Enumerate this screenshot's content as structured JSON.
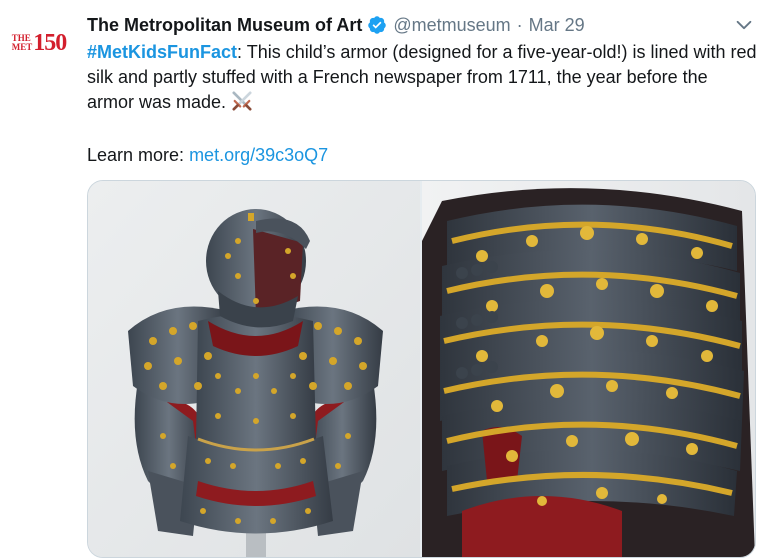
{
  "tweet": {
    "avatar": {
      "logo_small": "THE\nMET",
      "logo_number": "150"
    },
    "display_name": "The Metropolitan Museum of Art",
    "handle": "@metmuseum",
    "separator": "·",
    "date": "Mar 29",
    "hashtag": "#MetKidsFunFact",
    "body": ": This child’s armor (designed for a five-year-old!) is lined with red silk and partly stuffed with a French newspaper from 1711, the year before the armor was made.",
    "learn_prefix": "Learn more: ",
    "link_text": "met.org/39c3oQ7"
  },
  "icons": {
    "verified": "verified-badge-icon",
    "menu": "chevron-down-icon",
    "emoji": "crossed-swords-icon"
  },
  "colors": {
    "link": "#1b95e0",
    "secondary_text": "#657786",
    "brand_red": "#d31f2d"
  }
}
